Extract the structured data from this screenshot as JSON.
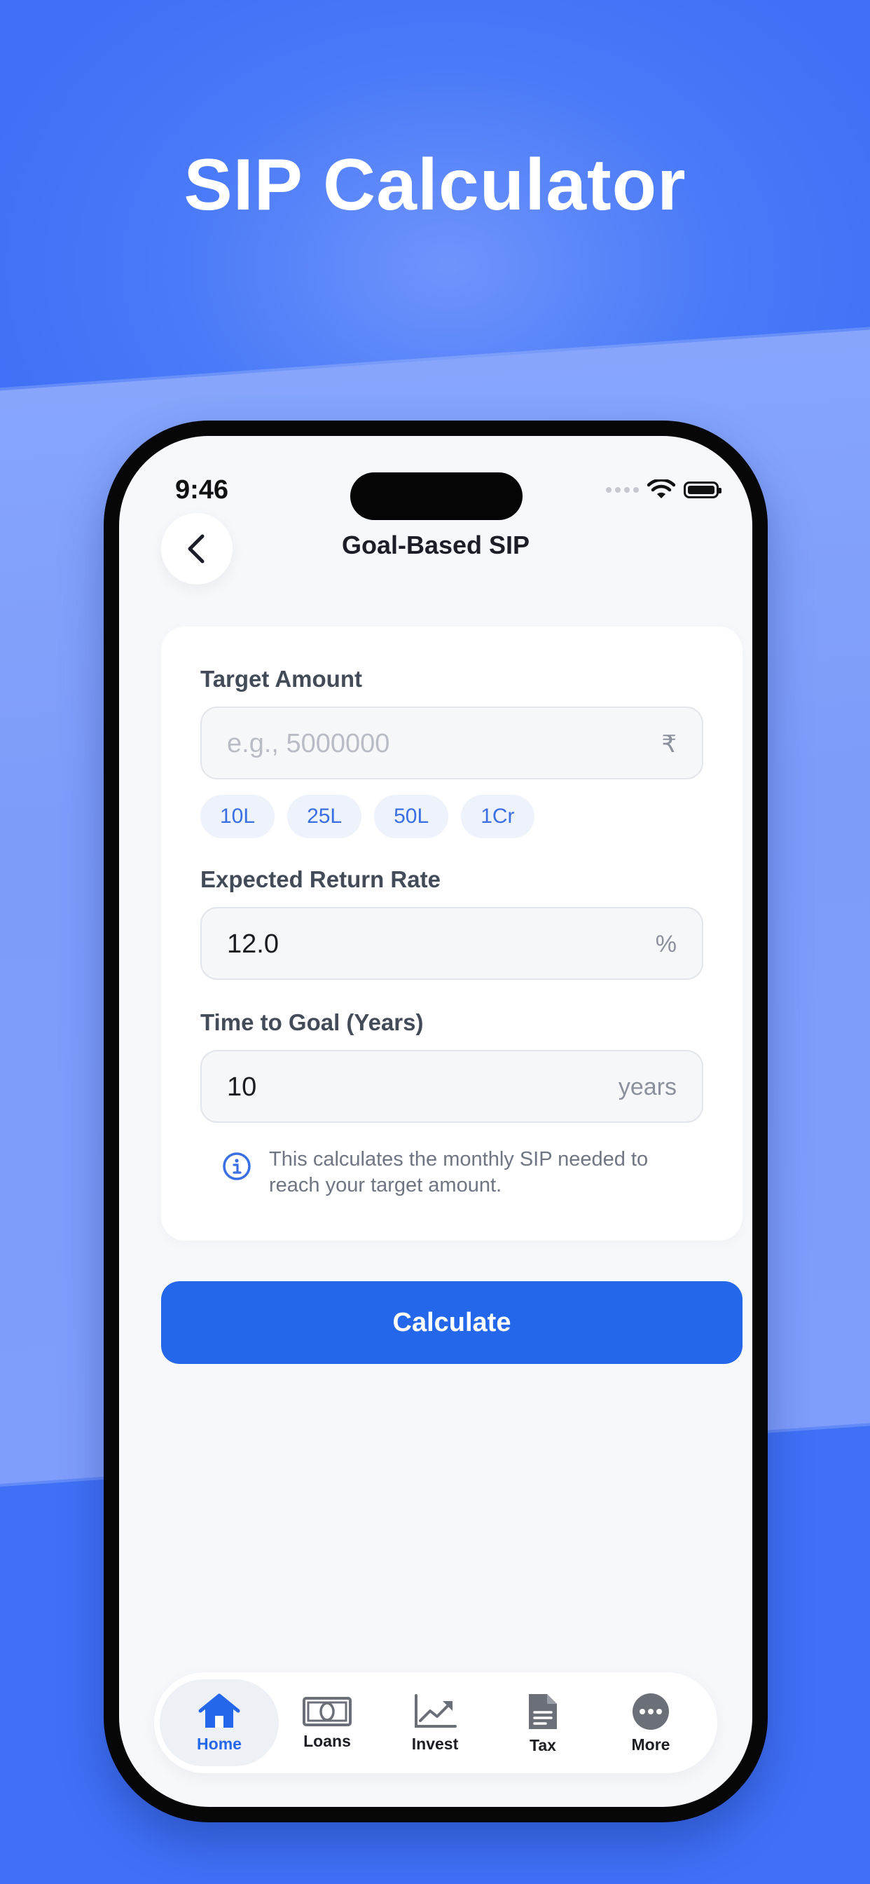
{
  "headline": "SIP Calculator",
  "status": {
    "time": "9:46"
  },
  "nav": {
    "title": "Goal-Based SIP"
  },
  "form": {
    "target": {
      "label": "Target Amount",
      "placeholder": "e.g., 5000000",
      "unit": "₹",
      "chips": [
        "10L",
        "25L",
        "50L",
        "1Cr"
      ]
    },
    "rate": {
      "label": "Expected Return Rate",
      "value": "12.0",
      "unit": "%"
    },
    "time": {
      "label": "Time to Goal (Years)",
      "value": "10",
      "unit": "years"
    },
    "info": "This calculates the monthly SIP needed to reach your target amount."
  },
  "calculate_label": "Calculate",
  "tabs": [
    {
      "label": "Home",
      "icon": "home-icon"
    },
    {
      "label": "Loans",
      "icon": "banknote-icon"
    },
    {
      "label": "Invest",
      "icon": "chart-icon"
    },
    {
      "label": "Tax",
      "icon": "document-icon"
    },
    {
      "label": "More",
      "icon": "more-icon"
    }
  ],
  "colors": {
    "accent": "#2567ea",
    "background": "#4a7af8"
  }
}
